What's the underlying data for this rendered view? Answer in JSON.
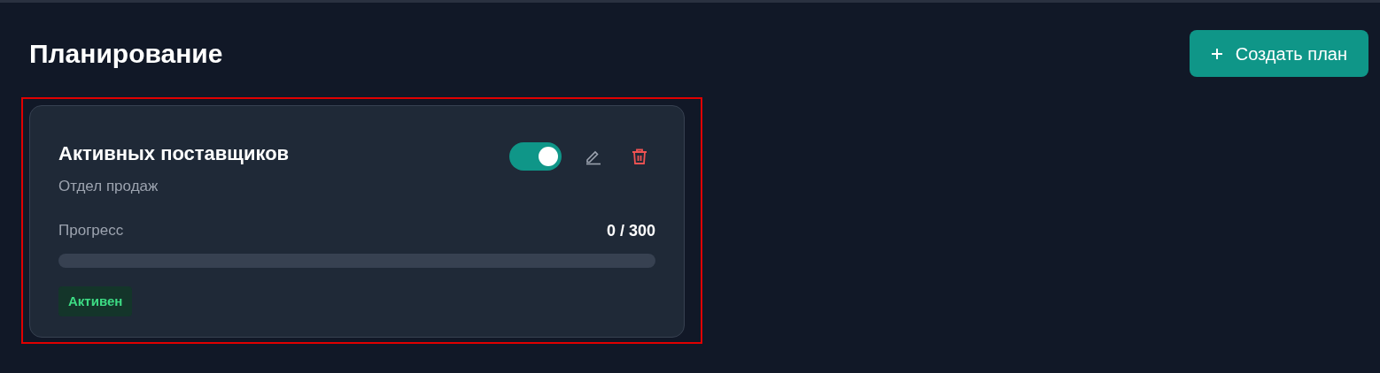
{
  "page": {
    "title": "Планирование"
  },
  "create_button": {
    "label": "Создать план"
  },
  "plans": [
    {
      "title": "Активных поставщиков",
      "subtitle": "Отдел продаж",
      "on": true,
      "highlighted": true,
      "progress_label": "Прогресс",
      "progress_reading": "0 / 300",
      "level": 0,
      "status": {
        "label": "Активен",
        "kind": "active"
      }
    }
  ]
}
